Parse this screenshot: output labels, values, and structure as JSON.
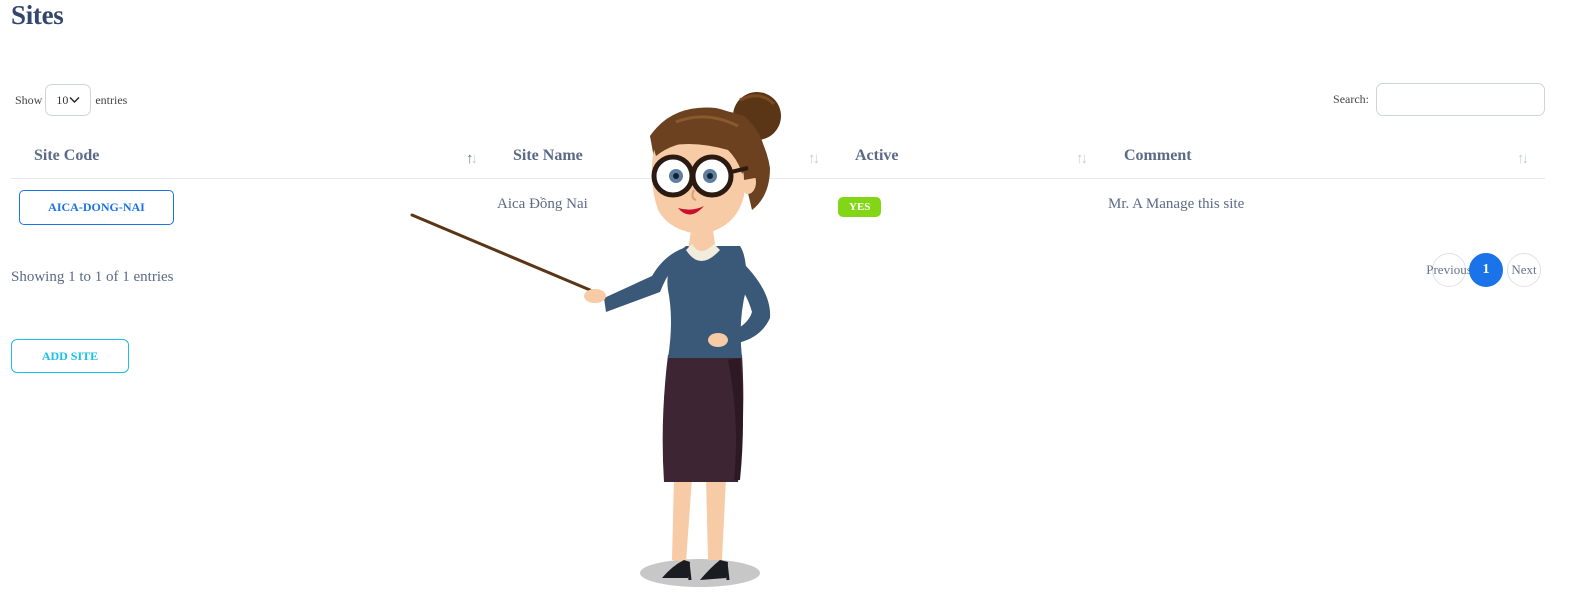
{
  "page": {
    "title": "Sites"
  },
  "length_control": {
    "prefix": "Show",
    "value": "10",
    "suffix": "entries"
  },
  "search": {
    "label": "Search:",
    "placeholder": "",
    "value": ""
  },
  "table": {
    "columns": [
      {
        "label": "Site Code"
      },
      {
        "label": "Site Name"
      },
      {
        "label": "Active"
      },
      {
        "label": "Comment"
      }
    ],
    "rows": [
      {
        "site_code": "AICA-DONG-NAI",
        "site_name": "Aica Đồng Nai",
        "active": "YES",
        "comment": "Mr. A Manage this site"
      }
    ]
  },
  "info": {
    "text": "Showing 1 to 1 of 1 entries"
  },
  "pagination": {
    "previous": "Previous",
    "current": "1",
    "next": "Next"
  },
  "actions": {
    "add_site": "ADD SITE"
  },
  "colors": {
    "primary": "#1a73e8",
    "info": "#17c1e8",
    "success": "#82d616",
    "heading": "#33466b",
    "text": "#5b6a86"
  },
  "illustration": {
    "name": "teacher-with-pointer"
  }
}
